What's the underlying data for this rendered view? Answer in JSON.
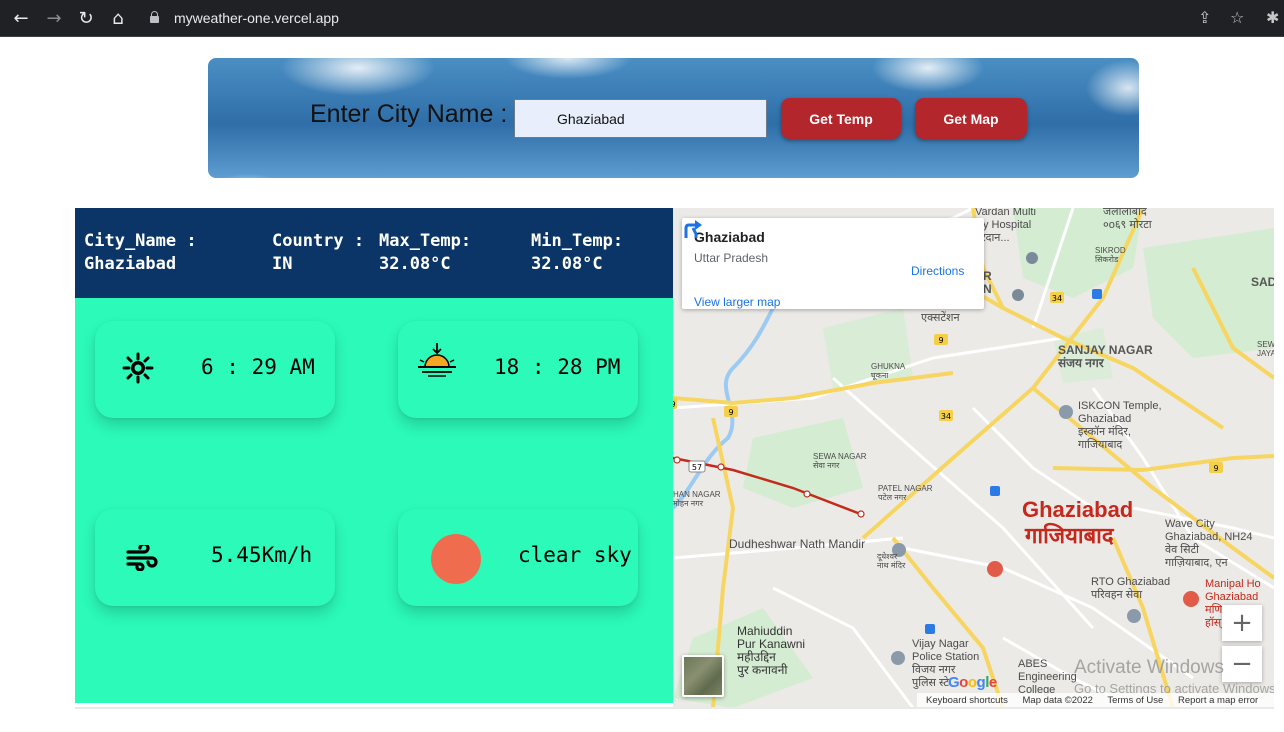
{
  "browser": {
    "url": "myweather-one.vercel.app",
    "icons": [
      "back-icon",
      "forward-icon",
      "reload-icon",
      "home-icon",
      "lock-icon",
      "share-icon",
      "star-icon",
      "extensions-icon"
    ]
  },
  "search": {
    "label": "Enter City Name :",
    "input_value": "Ghaziabad",
    "get_temp_label": "Get Temp",
    "get_map_label": "Get Map"
  },
  "weather": {
    "city_label": "City_Name :",
    "city_value": "Ghaziabad",
    "country_label": "Country :",
    "country_value": "IN",
    "max_label": "Max_Temp:",
    "max_value": "32.08°C",
    "min_label": "Min_Temp:",
    "min_value": "32.08°C",
    "sunrise": "6 : 29 AM",
    "sunset": "18 : 28 PM",
    "wind": "5.45Km/h",
    "description": "clear sky",
    "colors": {
      "header": "#0b3566",
      "panel": "#2bfab8",
      "weather_dot": "#ef6c4f"
    }
  },
  "map": {
    "info_title": "Ghaziabad",
    "info_subtitle": "Uttar Pradesh",
    "directions_label": "Directions",
    "view_larger": "View larger map",
    "city_label_en": "Ghaziabad",
    "city_label_hi": "गाजियाबाद",
    "labels": {
      "vardan": "Vardan Multi\nlity Hospital\nवरदान...",
      "jalalabad": "जलालाबाद\n०o६९ मोरटा",
      "sikrod": "SIKROD\nसिकरोड",
      "sada": "SADA",
      "sew": "SEW\nJAYANT",
      "r_frag": "R\nN",
      "extension": "एक्सटेंशन",
      "ghukna": "GHUKNA\nघूकना",
      "sanjay": "SANJAY NAGAR\nसंजय नगर",
      "iskcon": "ISKCON Temple,\nGhaziabad\nइस्कॉन मंदिर,\nगाजियाबाद",
      "sewa": "SEWA NAGAR\nसेवा नगर",
      "patel": "PATEL NAGAR\nपटेल नगर",
      "han": "HAN NAGAR\nमोहन नगर",
      "dudheshwar": "Dudheshwar Nath Mandir",
      "dudheshwar_hi": "दूधेश्वर\nनाथ मंदिर",
      "wave": "Wave City\nGhaziabad, NH24\nवेव सिटी\nगाज़ियाबाद, एन",
      "rto": "RTO Ghaziabad\nपरिवहन सेवा",
      "manipal": "Manipal Ho\nGhaziabad\nमणि\nहॉस्",
      "mahiuddin": "Mahiuddin\nPur Kanawni\nमहीउद्दिन\nपुर कनावनी",
      "vijay": "Vijay Nagar\nPolice Station\nविजय नगर\nपुलिस स्टे",
      "abes": "ABES\nEngineering\nCollege"
    },
    "road_numbers": [
      "9",
      "34",
      "9",
      "34",
      "9",
      "57",
      "9",
      "34"
    ],
    "attribution": [
      "Keyboard shortcuts",
      "Map data ©2022",
      "Terms of Use",
      "Report a map error"
    ],
    "google": "Google"
  },
  "overlay": {
    "activate_line1": "Activate Windows",
    "activate_line2": "Go to Settings to activate Windows."
  }
}
